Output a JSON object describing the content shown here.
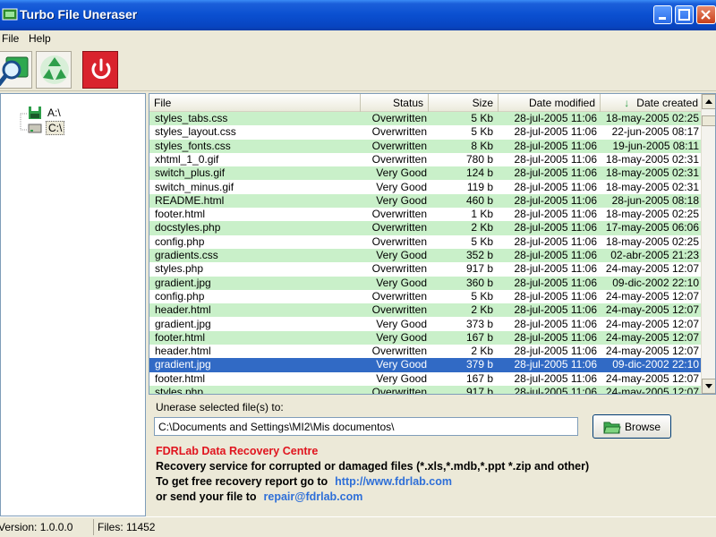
{
  "window": {
    "title": "Turbo File Uneraser"
  },
  "menu": {
    "items": [
      "File",
      "Help"
    ]
  },
  "toolbar": {
    "buttons": [
      {
        "icon": "search-magnifier-icon"
      },
      {
        "icon": "recycle-icon"
      },
      {
        "icon": "power-icon"
      }
    ]
  },
  "tree": {
    "items": [
      {
        "label": "A:\\",
        "icon": "floppy-drive-icon"
      },
      {
        "label": "C:\\",
        "icon": "hard-drive-icon"
      }
    ]
  },
  "table": {
    "columns": [
      "File",
      "Status",
      "Size",
      "Date modified",
      "Date created"
    ],
    "sort_indicator": "↓",
    "rows": [
      [
        "styles_tabs.css",
        "Overwritten",
        "5 Kb",
        "28-jul-2005 11:06",
        "18-may-2005 02:25"
      ],
      [
        "styles_layout.css",
        "Overwritten",
        "5 Kb",
        "28-jul-2005 11:06",
        "22-jun-2005 08:17"
      ],
      [
        "styles_fonts.css",
        "Overwritten",
        "8 Kb",
        "28-jul-2005 11:06",
        "19-jun-2005 08:11"
      ],
      [
        "xhtml_1_0.gif",
        "Overwritten",
        "780 b",
        "28-jul-2005 11:06",
        "18-may-2005 02:31"
      ],
      [
        "switch_plus.gif",
        "Very Good",
        "124 b",
        "28-jul-2005 11:06",
        "18-may-2005 02:31"
      ],
      [
        "switch_minus.gif",
        "Very Good",
        "119 b",
        "28-jul-2005 11:06",
        "18-may-2005 02:31"
      ],
      [
        "README.html",
        "Very Good",
        "460 b",
        "28-jul-2005 11:06",
        "28-jun-2005 08:18"
      ],
      [
        "footer.html",
        "Overwritten",
        "1 Kb",
        "28-jul-2005 11:06",
        "18-may-2005 02:25"
      ],
      [
        "docstyles.php",
        "Overwritten",
        "2 Kb",
        "28-jul-2005 11:06",
        "17-may-2005 06:06"
      ],
      [
        "config.php",
        "Overwritten",
        "5 Kb",
        "28-jul-2005 11:06",
        "18-may-2005 02:25"
      ],
      [
        "gradients.css",
        "Very Good",
        "352 b",
        "28-jul-2005 11:06",
        "02-abr-2005 21:23"
      ],
      [
        "styles.php",
        "Overwritten",
        "917 b",
        "28-jul-2005 11:06",
        "24-may-2005 12:07"
      ],
      [
        "gradient.jpg",
        "Very Good",
        "360 b",
        "28-jul-2005 11:06",
        "09-dic-2002 22:10"
      ],
      [
        "config.php",
        "Overwritten",
        "5 Kb",
        "28-jul-2005 11:06",
        "24-may-2005 12:07"
      ],
      [
        "header.html",
        "Overwritten",
        "2 Kb",
        "28-jul-2005 11:06",
        "24-may-2005 12:07"
      ],
      [
        "gradient.jpg",
        "Very Good",
        "373 b",
        "28-jul-2005 11:06",
        "24-may-2005 12:07"
      ],
      [
        "footer.html",
        "Very Good",
        "167 b",
        "28-jul-2005 11:06",
        "24-may-2005 12:07"
      ],
      [
        "header.html",
        "Overwritten",
        "2 Kb",
        "28-jul-2005 11:06",
        "24-may-2005 12:07"
      ],
      [
        "gradient.jpg",
        "Very Good",
        "379 b",
        "28-jul-2005 11:06",
        "09-dic-2002 22:10"
      ],
      [
        "footer.html",
        "Very Good",
        "167 b",
        "28-jul-2005 11:06",
        "24-may-2005 12:07"
      ],
      [
        "styles.php",
        "Overwritten",
        "917 b",
        "28-jul-2005 11:06",
        "24-may-2005 12:07"
      ]
    ],
    "selected_row": 18
  },
  "unerase": {
    "label": "Unerase selected file(s) to:",
    "path": "C:\\Documents and Settings\\MI2\\Mis documentos\\",
    "browse_label": "Browse"
  },
  "promo": {
    "title": "FDRLab Data Recovery Centre",
    "line1": "Recovery service for corrupted or damaged files (*.xls,*.mdb,*.ppt *.zip and other)",
    "line2": "To get free recovery report go to",
    "link1": "http://www.fdrlab.com",
    "line3": "or send your file to",
    "link2": "repair@fdrlab.com"
  },
  "status": {
    "version": "Version: 1.0.0.0",
    "files": "Files: 11452"
  },
  "colors": {
    "row_even": "#C9F0C9",
    "row_odd": "#FFFFFF",
    "row_selected": "#316AC5",
    "promo_title": "#E0141E",
    "promo_link": "#2E6FD8",
    "titlebar": "#0A4FD0"
  }
}
